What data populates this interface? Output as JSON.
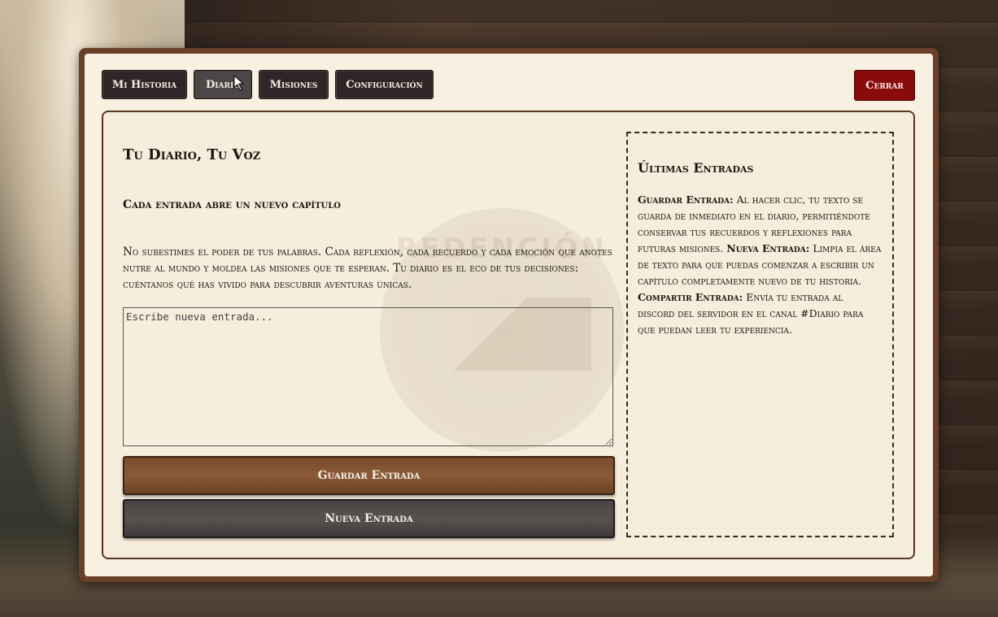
{
  "tabs": [
    {
      "label": "Mi Historia",
      "active": false
    },
    {
      "label": "Diario",
      "active": true
    },
    {
      "label": "Misiones",
      "active": false
    },
    {
      "label": "Configuración",
      "active": false
    }
  ],
  "close_label": "Cerrar",
  "watermark_text": "REDENCIÓN",
  "main": {
    "title": "Tu Diario, Tu Voz",
    "subtitle": "Cada entrada abre un nuevo capítulo",
    "description": "No subestimes el poder de tus palabras. Cada reflexión, cada recuerdo y cada emoción que anotes nutre al mundo y moldea las misiones que te esperan. Tu diario es el eco de tus decisiones: cuéntanos qué has vivido para descubrir aventuras únicas.",
    "entry_placeholder": "Escribe nueva entrada...",
    "entry_value": "",
    "save_label": "Guardar Entrada",
    "new_label": "Nueva Entrada"
  },
  "sidebar": {
    "title": "Últimas Entradas",
    "items": [
      {
        "term": "Guardar Entrada:",
        "text": " Al hacer clic, tu texto se guarda de inmediato en el diario, permitiéndote conservar tus recuerdos y reflexiones para futuras misiones. "
      },
      {
        "term": "Nueva Entrada:",
        "text": " Limpia el área de texto para que puedas comenzar a escribir un capítulo completamente nuevo de tu historia. "
      },
      {
        "term": "Compartir Entrada:",
        "text": " Envía tu entrada al discord del servidor en el canal #Diario para que puedan leer tu experiencia."
      }
    ]
  },
  "colors": {
    "frame": "#6b4029",
    "panel": "#f8f0e1",
    "tab": "#2e2626",
    "close": "#8a0b0b",
    "save": "#7a4c2e",
    "new": "#4a4446"
  }
}
